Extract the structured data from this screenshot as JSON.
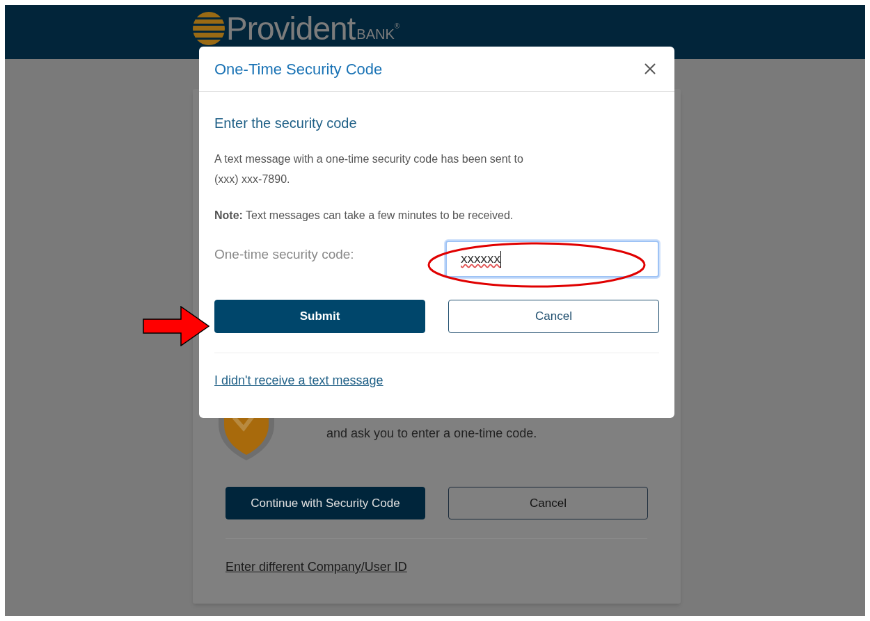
{
  "header": {
    "logo_name": "Provident",
    "logo_suffix": "BANK",
    "logo_mark": "®"
  },
  "background_card": {
    "text": "and ask you to enter a one-time code.",
    "buttons": [
      {
        "label": "Continue with Security Code",
        "kind": "primary"
      },
      {
        "label": "Cancel",
        "kind": "secondary"
      }
    ],
    "link": "Enter different Company/User ID"
  },
  "dialog": {
    "title": "One-Time Security Code",
    "heading": "Enter the security code",
    "message": "A text message with a one-time security code has been sent to\n(xxx) xxx-7890.",
    "note": "**Note:** Text messages can take a few minutes to be received.",
    "field": {
      "label": "One-time security code:",
      "value": "xxxxxx",
      "focused": true
    },
    "buttons": [
      {
        "label": "Submit",
        "kind": "primary"
      },
      {
        "label": "Cancel",
        "kind": "secondary"
      }
    ],
    "link": "I didn't receive a text message"
  }
}
